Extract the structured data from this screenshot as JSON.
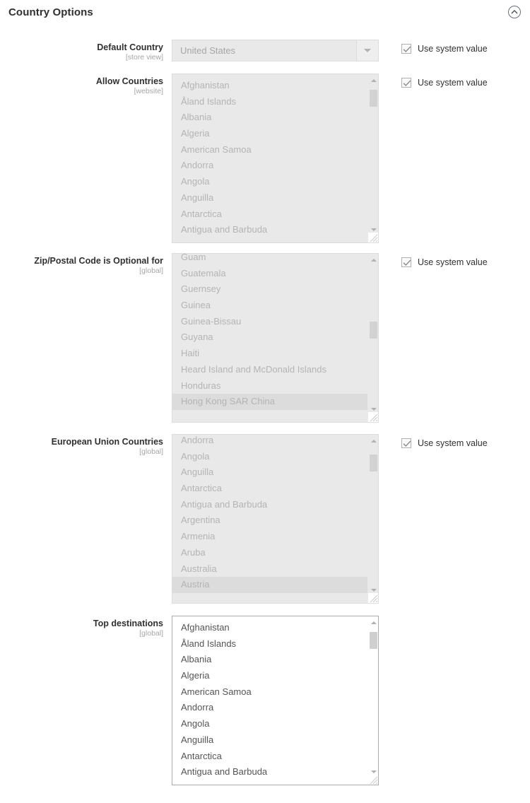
{
  "section": {
    "title": "Country Options",
    "collapse_icon": "chevron-up-circle-icon"
  },
  "inherit_label": "Use system value",
  "fields": [
    {
      "label": "Default Country",
      "scope": "[store view]",
      "type": "select",
      "value": "United States",
      "disabled": true,
      "dropdown_icon": "chevron-down-icon",
      "has_inherit": true,
      "inherit_checked": true
    },
    {
      "label": "Allow Countries",
      "scope": "[website]",
      "type": "multiselect",
      "disabled": true,
      "has_inherit": true,
      "inherit_checked": true,
      "options": [
        "Afghanistan",
        "Åland Islands",
        "Albania",
        "Algeria",
        "American Samoa",
        "Andorra",
        "Angola",
        "Anguilla",
        "Antarctica",
        "Antigua and Barbuda"
      ],
      "selected": []
    },
    {
      "label": "Zip/Postal Code is Optional for",
      "scope": "[global]",
      "type": "multiselect",
      "disabled": true,
      "has_inherit": true,
      "inherit_checked": true,
      "options": [
        "Guam",
        "Guatemala",
        "Guernsey",
        "Guinea",
        "Guinea-Bissau",
        "Guyana",
        "Haiti",
        "Heard Island and McDonald Islands",
        "Honduras",
        "Hong Kong SAR China"
      ],
      "selected": [
        "Hong Kong SAR China"
      ]
    },
    {
      "label": "European Union Countries",
      "scope": "[global]",
      "type": "multiselect",
      "disabled": true,
      "has_inherit": true,
      "inherit_checked": true,
      "options": [
        "Andorra",
        "Angola",
        "Anguilla",
        "Antarctica",
        "Antigua and Barbuda",
        "Argentina",
        "Armenia",
        "Aruba",
        "Australia",
        "Austria"
      ],
      "selected": [
        "Austria"
      ]
    },
    {
      "label": "Top destinations",
      "scope": "[global]",
      "type": "multiselect",
      "disabled": false,
      "has_inherit": false,
      "inherit_checked": false,
      "options": [
        "Afghanistan",
        "Åland Islands",
        "Albania",
        "Algeria",
        "American Samoa",
        "Andorra",
        "Angola",
        "Anguilla",
        "Antarctica",
        "Antigua and Barbuda"
      ],
      "selected": []
    }
  ],
  "colors": {
    "text": "#303030",
    "muted": "#a6a6a6",
    "disabled_bg": "#e9e9e9",
    "border": "#dcdcdc",
    "selected_bg": "#dcdcdc"
  }
}
